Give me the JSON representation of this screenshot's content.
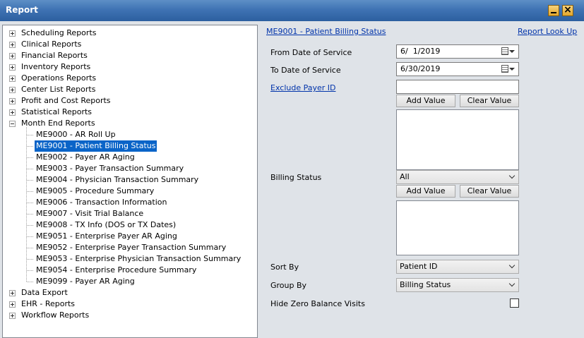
{
  "window": {
    "title": "Report"
  },
  "tree": {
    "top_items": [
      {
        "label": "Scheduling Reports"
      },
      {
        "label": "Clinical Reports"
      },
      {
        "label": "Financial Reports"
      },
      {
        "label": "Inventory Reports"
      },
      {
        "label": "Operations Reports"
      },
      {
        "label": "Center List Reports"
      },
      {
        "label": "Profit and Cost Reports"
      },
      {
        "label": "Statistical Reports"
      }
    ],
    "expanded": {
      "label": "Month End Reports",
      "children": [
        {
          "label": "ME9000 - AR Roll Up"
        },
        {
          "label": "ME9001 - Patient Billing Status"
        },
        {
          "label": "ME9002 - Payer AR Aging"
        },
        {
          "label": "ME9003 - Payer Transaction Summary"
        },
        {
          "label": "ME9004 - Physician Transaction Summary"
        },
        {
          "label": "ME9005 - Procedure Summary"
        },
        {
          "label": "ME9006 - Transaction Information"
        },
        {
          "label": "ME9007 - Visit Trial Balance"
        },
        {
          "label": "ME9008 - TX Info (DOS or TX Dates)"
        },
        {
          "label": "ME9051 - Enterprise Payer AR Aging"
        },
        {
          "label": "ME9052 - Enterprise Payer Transaction Summary"
        },
        {
          "label": "ME9053 - Enterprise Physician Transaction Summary"
        },
        {
          "label": "ME9054 - Enterprise Procedure Summary"
        },
        {
          "label": "ME9099 - Payer AR Aging"
        }
      ]
    },
    "bottom_items": [
      {
        "label": "Data Export"
      },
      {
        "label": "EHR - Reports"
      },
      {
        "label": "Workflow Reports"
      }
    ]
  },
  "panel": {
    "report_title": "ME9001 - Patient Billing Status",
    "lookup_link": "Report Look Up",
    "from_label": "From Date of Service",
    "from_value": "6/  1/2019",
    "to_label": "To Date of Service",
    "to_value": "6/30/2019",
    "exclude_payer_label": "Exclude Payer ID",
    "exclude_payer_value": "",
    "add_value_label": "Add Value",
    "clear_value_label": "Clear Value",
    "billing_status_label": "Billing Status",
    "billing_status_value": "All",
    "sort_by_label": "Sort By",
    "sort_by_value": "Patient ID",
    "group_by_label": "Group By",
    "group_by_value": "Billing Status",
    "hide_zero_label": "Hide Zero Balance Visits",
    "hide_zero_checked": false
  }
}
